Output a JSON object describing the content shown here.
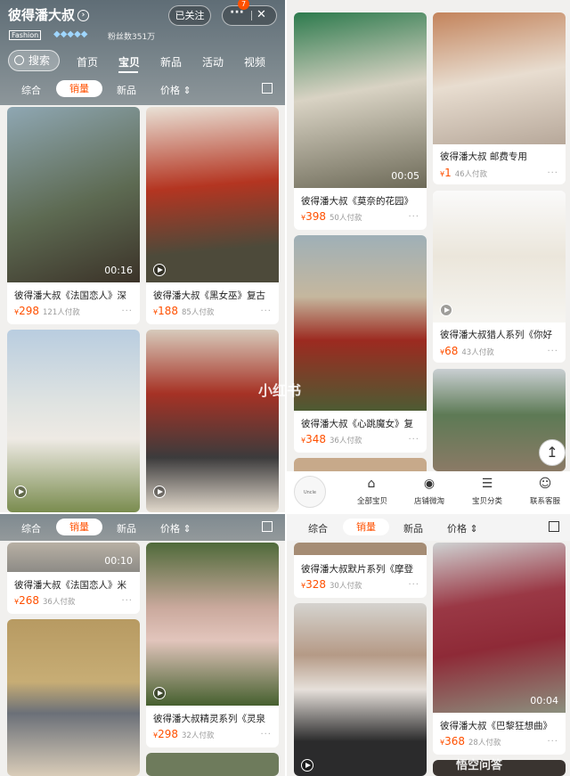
{
  "shop": {
    "name": "彼得潘大叔",
    "follow": "已关注",
    "badge": "7",
    "fashion_tag": "Fashion",
    "fans": "粉丝数351万",
    "search": "搜索",
    "nav": [
      "首页",
      "宝贝",
      "新品",
      "活动",
      "视频"
    ]
  },
  "sort": {
    "items": [
      "综合",
      "销量",
      "新品",
      "价格"
    ],
    "active": "销量"
  },
  "q1_cards": [
    {
      "title": "彼得潘大叔《法国恋人》深",
      "price": "298",
      "sales": "121人付款",
      "duration": "00:16"
    },
    {
      "title": "彼得潘大叔《黑女巫》复古",
      "price": "188",
      "sales": "85人付款"
    },
    {
      "title": "",
      "price": "",
      "sales": ""
    },
    {
      "title": "",
      "price": "",
      "sales": ""
    }
  ],
  "q2_cards": [
    {
      "title": "彼得潘大叔《莫奈的花园》",
      "price": "398",
      "sales": "50人付款",
      "duration": "00:05"
    },
    {
      "title": "彼得潘大叔 邮费专用",
      "price": "1",
      "sales": "46人付款"
    },
    {
      "title": "彼得潘大叔猎人系列《你好",
      "price": "68",
      "sales": "43人付款"
    },
    {
      "title": "彼得潘大叔《心跳魔女》复",
      "price": "348",
      "sales": "36人付款"
    }
  ],
  "watermark": "小红书",
  "bottom_bar": {
    "logo": "Uncle Peterpan",
    "items": [
      "全部宝贝",
      "店铺微淘",
      "宝贝分类",
      "联系客服"
    ]
  },
  "q3_cards": [
    {
      "title": "彼得潘大叔《法国恋人》米",
      "price": "268",
      "sales": "36人付款",
      "duration": "00:10"
    },
    {
      "title": "彼得潘大叔精灵系列《灵泉",
      "price": "298",
      "sales": "32人付款"
    }
  ],
  "q4_cards": [
    {
      "title": "彼得潘大叔默片系列《摩登",
      "price": "328",
      "sales": "30人付款"
    },
    {
      "title": "彼得潘大叔《巴黎狂想曲》",
      "price": "368",
      "sales": "28人付款",
      "duration": "00:04"
    }
  ],
  "corner_watermark": "悟空问答",
  "currency": "¥",
  "more": "···"
}
